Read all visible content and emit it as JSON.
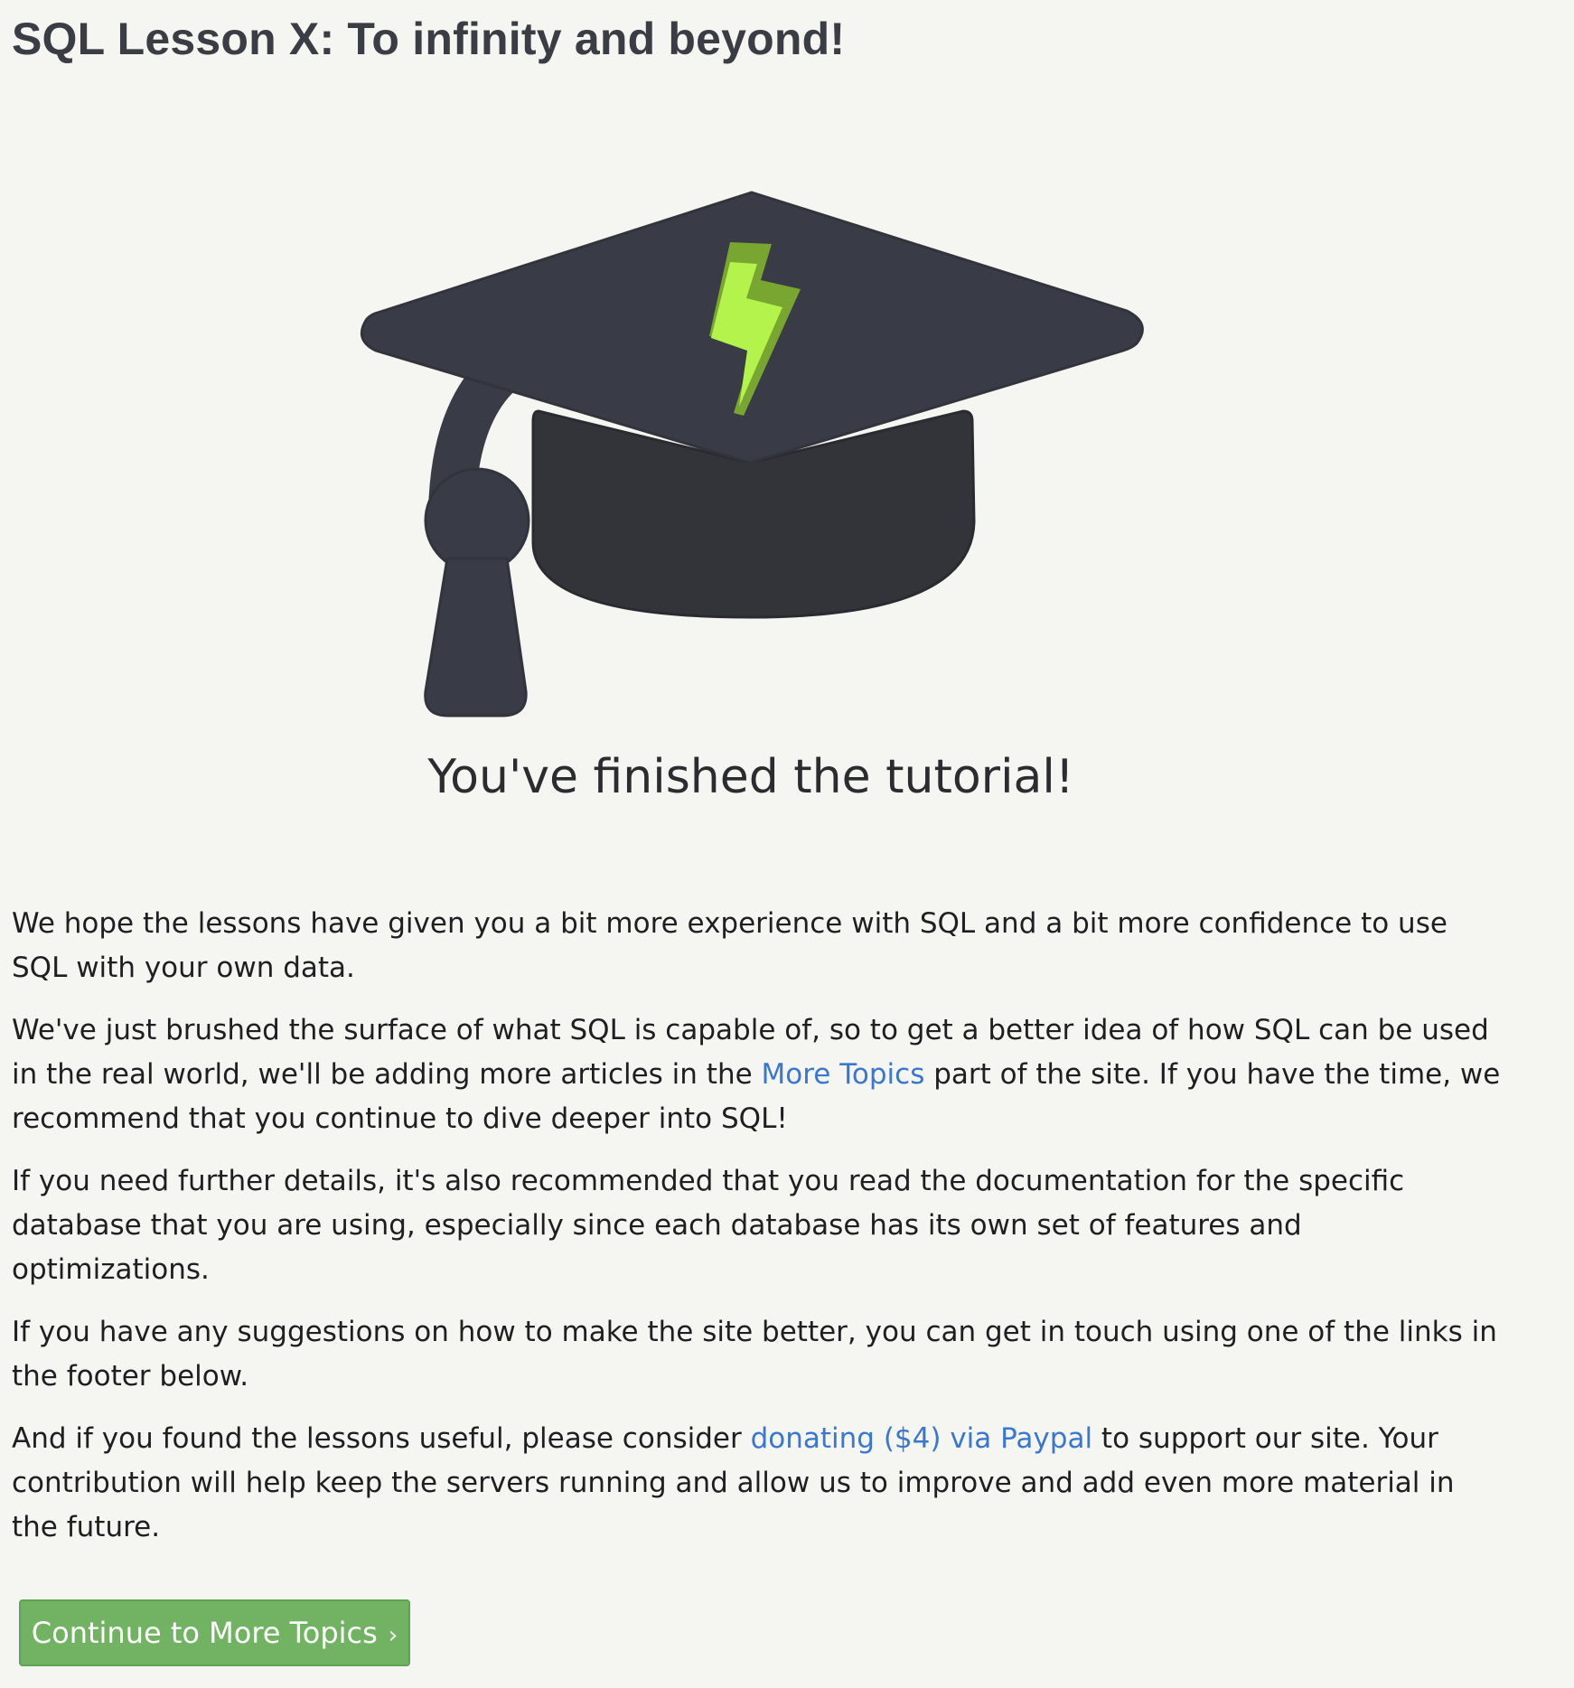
{
  "lesson": {
    "title": "SQL Lesson X: To infinity and beyond!"
  },
  "hero": {
    "icon": "graduation-cap-with-lightning-bolt",
    "caption": "You've finished the tutorial!",
    "colors": {
      "cap": "#393c46",
      "bolt_light": "#b3f34b",
      "bolt_dark": "#79a531"
    }
  },
  "body": {
    "p1": "We hope the lessons have given you a bit more experience with SQL and a bit more confidence to use SQL with your own data.",
    "p2_before": "We've just brushed the surface of what SQL is capable of, so to get a better idea of how SQL can be used in the real world, we'll be adding more articles in the ",
    "p2_link": "More Topics",
    "p2_after": " part of the site. If you have the time, we recommend that you continue to dive deeper into SQL!",
    "p3": "If you need further details, it's also recommended that you read the documentation for the specific database that you are using, especially since each database has its own set of features and optimizations.",
    "p4": "If you have any suggestions on how to make the site better, you can get in touch using one of the links in the footer below.",
    "p5_before": "And if you found the lessons useful, please consider ",
    "p5_link": "donating ($4) via Paypal",
    "p5_after": " to support our site. Your contribution will help keep the servers running and allow us to improve and add even more material in the future."
  },
  "actions": {
    "continue_label": "Continue to More Topics",
    "continue_chevron": "›",
    "colors": {
      "button": "#71b362",
      "link": "#3a77d0"
    }
  }
}
